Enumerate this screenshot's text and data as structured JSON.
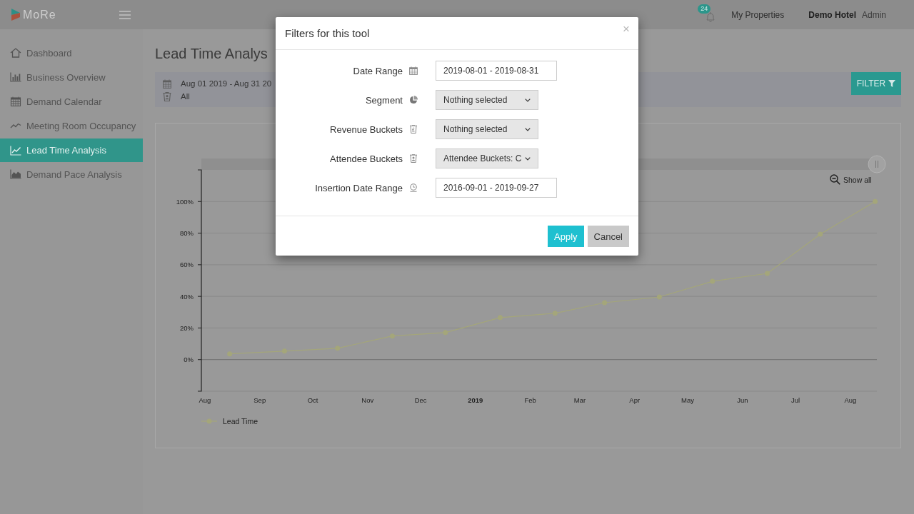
{
  "top_bar": {
    "logo": "MoRe",
    "notification_count": "24",
    "links": [
      {
        "label": "My Properties"
      }
    ],
    "hotel": "Demo Hotel",
    "user": "Admin"
  },
  "sidebar": {
    "items": [
      {
        "label": "Dashboard",
        "selected": false
      },
      {
        "label": "Business Overview",
        "selected": false
      },
      {
        "label": "Demand Calendar",
        "selected": false
      },
      {
        "label": "Meeting Room Occupancy",
        "selected": false
      },
      {
        "label": "Lead Time Analysis",
        "selected": true
      },
      {
        "label": "Demand Pace Analysis",
        "selected": false
      }
    ]
  },
  "page": {
    "title": "Lead Time Analys"
  },
  "filter_summary": {
    "items": [
      "Aug 01 2019 - Aug 31 20",
      "All"
    ],
    "button": "FILTER"
  },
  "chart": {
    "show_all": "Show all",
    "chart_data": [
      {
        "type": "line",
        "x": [
          "2018-08-15",
          "2018-09-15",
          "2018-10-15",
          "2018-11-15",
          "2018-12-15",
          "2019-01-15",
          "2019-02-15",
          "2019-03-15",
          "2019-04-15",
          "2019-05-15",
          "2019-06-15",
          "2019-07-15",
          "2019-08-15"
        ],
        "series": [
          {
            "name": "Lead Time",
            "color": "#a4a67a",
            "values": [
              3.6,
              5.4,
              7.2,
              14.9,
              17.1,
              26.6,
              29.3,
              36,
              39.6,
              49.5,
              54.5,
              79.3,
              100
            ]
          }
        ],
        "xlim": [
          "2018-07-30",
          "2019-08-16"
        ],
        "ylim": [
          -20,
          120
        ],
        "yticks": [
          {
            "value": 0,
            "label": "0%"
          },
          {
            "value": 20,
            "label": "20%"
          },
          {
            "value": 40,
            "label": "40%"
          },
          {
            "value": 60,
            "label": "60%"
          },
          {
            "value": 80,
            "label": "80%"
          },
          {
            "value": 100,
            "label": "100%"
          }
        ],
        "xticks": [
          {
            "value": "2018-08-01",
            "label": "Aug"
          },
          {
            "value": "2018-09-01",
            "label": "Sep"
          },
          {
            "value": "2018-10-01",
            "label": "Oct"
          },
          {
            "value": "2018-11-01",
            "label": "Nov"
          },
          {
            "value": "2018-12-01",
            "label": "Dec"
          },
          {
            "value": "2019-01-01",
            "label": "2019"
          },
          {
            "value": "2019-02-01",
            "label": "Feb"
          },
          {
            "value": "2019-03-01",
            "label": "Mar"
          },
          {
            "value": "2019-04-01",
            "label": "Apr"
          },
          {
            "value": "2019-05-01",
            "label": "May"
          },
          {
            "value": "2019-06-01",
            "label": "Jun"
          },
          {
            "value": "2019-07-01",
            "label": "Jul"
          },
          {
            "value": "2019-08-01",
            "label": "Aug"
          }
        ],
        "grid": "y",
        "marker": "circle"
      }
    ]
  },
  "modal": {
    "title": "Filters for this tool",
    "close": "×",
    "fields": [
      {
        "label": "Date Range",
        "kind": "input",
        "value": "2019-08-01 - 2019-08-31"
      },
      {
        "label": "Segment",
        "kind": "select",
        "value": "Nothing selected"
      },
      {
        "label": "Revenue Buckets",
        "kind": "select",
        "value": "Nothing selected"
      },
      {
        "label": "Attendee Buckets",
        "kind": "select",
        "value": "Attendee Buckets: C"
      },
      {
        "label": "Insertion Date Range",
        "kind": "input",
        "value": "2016-09-01 - 2019-09-27"
      }
    ],
    "buttons": [
      {
        "label": "Apply",
        "kind": "primary"
      },
      {
        "label": "Cancel",
        "kind": "secondary"
      }
    ]
  }
}
